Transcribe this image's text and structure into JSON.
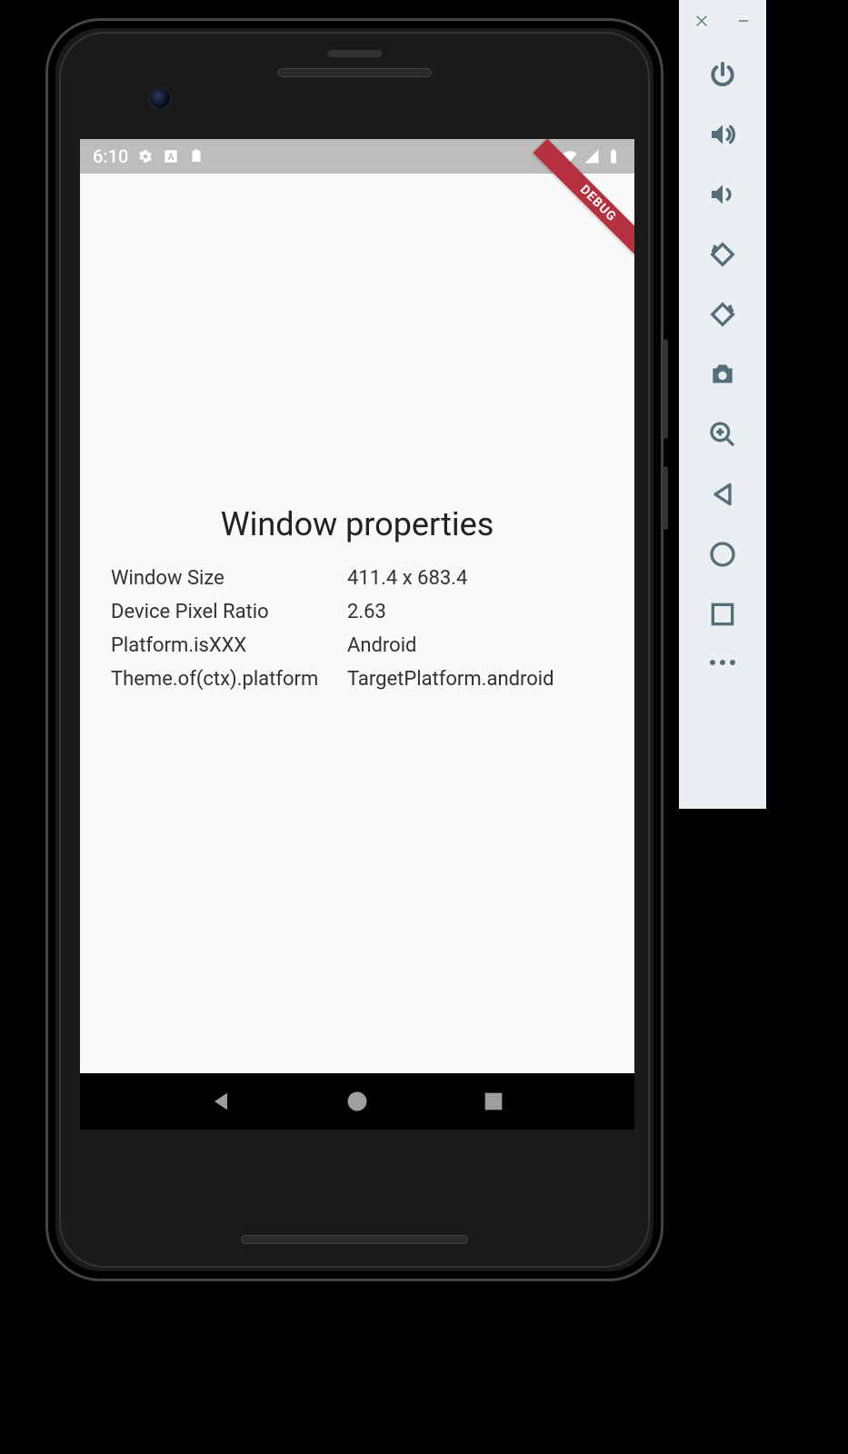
{
  "status_bar": {
    "time": "6:10",
    "icons": {
      "settings": "settings-icon",
      "text_a": "text-a-icon",
      "clipboard": "clipboard-icon",
      "wifi": "wifi-icon",
      "signal": "signal-icon",
      "battery": "battery-icon"
    }
  },
  "debug_banner": "DEBUG",
  "page": {
    "title": "Window properties",
    "rows": [
      {
        "label": "Window Size",
        "value": "411.4 x 683.4"
      },
      {
        "label": "Device Pixel Ratio",
        "value": "2.63"
      },
      {
        "label": "Platform.isXXX",
        "value": "Android"
      },
      {
        "label": "Theme.of(ctx).platform",
        "value": "TargetPlatform.android"
      }
    ]
  },
  "nav_bar": {
    "back": "back",
    "home": "home",
    "recents": "recents"
  },
  "emu_toolbar": {
    "close": "close",
    "minimize": "minimize",
    "power": "power",
    "volume_up": "volume-up",
    "volume_down": "volume-down",
    "rotate_left": "rotate-left",
    "rotate_right": "rotate-right",
    "camera": "camera",
    "zoom": "zoom",
    "back": "back",
    "home": "home",
    "recents": "recents",
    "more": "more"
  }
}
